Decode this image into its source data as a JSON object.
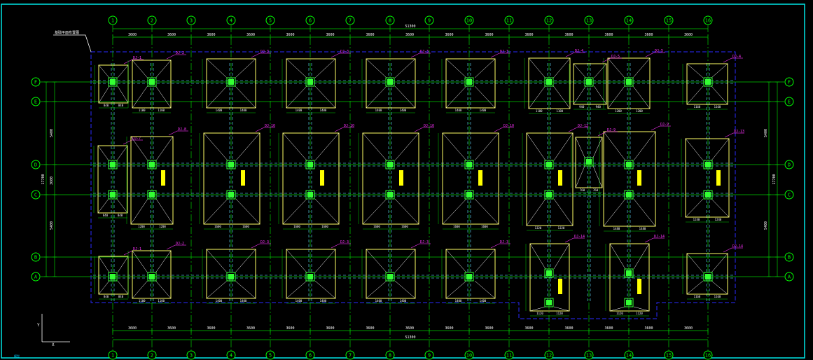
{
  "colors": {
    "background": "#000000",
    "frame": "#00e5e5",
    "grid_line": "#00cc00",
    "axis_bubble": "#00ff00",
    "footing": "#ffff66",
    "column": "#33ff33",
    "beam": "#4aa8c8",
    "boundary": "#2a2aff",
    "tag": "#ff33ff",
    "annotation": "#ffff00",
    "dim_text": "#ffffff"
  },
  "axes": {
    "top": [
      "1",
      "2",
      "3",
      "4",
      "5",
      "6",
      "7",
      "8",
      "9",
      "10",
      "11",
      "12",
      "13",
      "14",
      "15",
      "16"
    ],
    "bottom": [
      "1",
      "2",
      "3",
      "4",
      "5",
      "6",
      "7",
      "8",
      "9",
      "10",
      "11",
      "12",
      "13",
      "14",
      "15",
      "16"
    ],
    "left": [
      "F",
      "E",
      "D",
      "C",
      "B",
      "A"
    ],
    "right": [
      "F",
      "E",
      "D",
      "C",
      "B",
      "A"
    ]
  },
  "dimensions": {
    "top_total": "51300",
    "bottom_total": "51300",
    "bay": "3600",
    "left_total": "17700",
    "right_total": "17700",
    "left_upper": "5400",
    "left_mid": "3600",
    "left_lower": "5400"
  },
  "labels": {
    "section_tag": "DJ-1",
    "ucs_x": "X",
    "ucs_y": "Y",
    "title_tag": "基础平面布置图",
    "model_tag": "模型"
  },
  "footing_tags": {
    "row_top": [
      "DJ-1",
      "DJ-2",
      "DJ-3",
      "DJ-3",
      "DJ-3",
      "DJ-3",
      "DJ-4",
      "DJ-5",
      "DJ-4",
      "DJ-1"
    ],
    "row_mid": [
      "DJ-7",
      "DJ-8",
      "DJ-10",
      "DJ-10",
      "DJ-10",
      "DJ-10",
      "DJ-12",
      "DJ-9",
      "DJ-13",
      "DJ-13"
    ],
    "row_bot": [
      "DJ-1",
      "DJ-2",
      "DJ-3",
      "DJ-3",
      "DJ-3",
      "DJ-3",
      "DJ-14",
      "DJ-14",
      "DJ-1"
    ]
  }
}
